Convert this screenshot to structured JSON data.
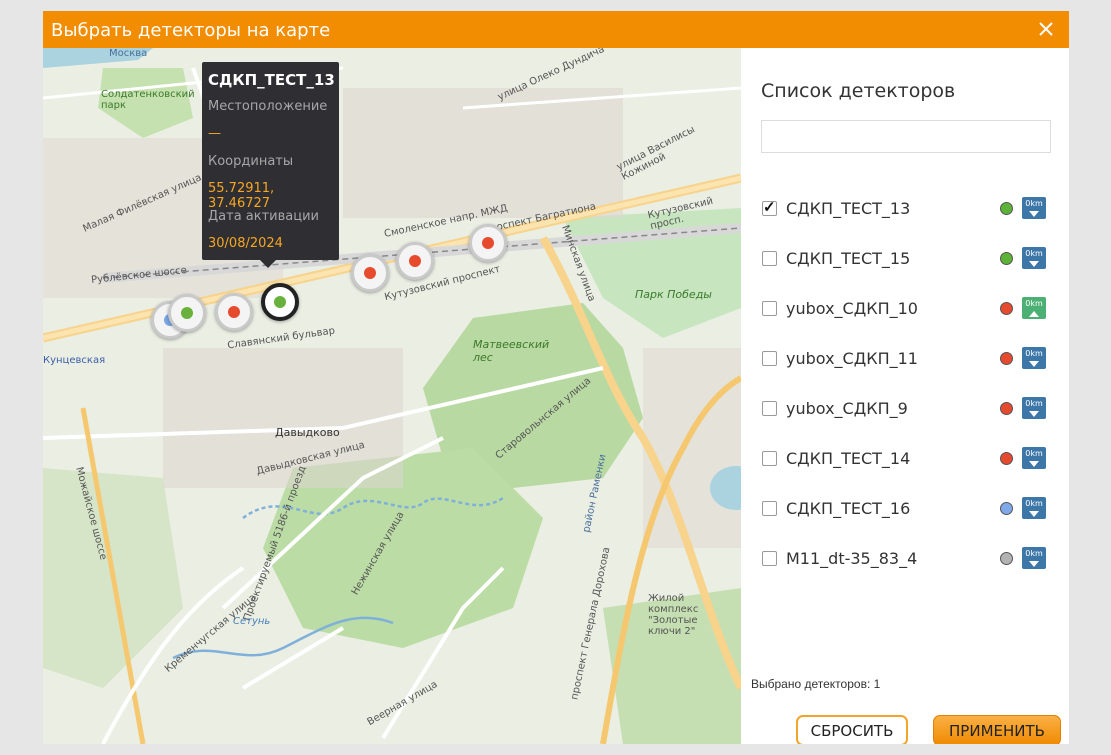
{
  "dialog": {
    "title": "Выбрать детекторы на карте",
    "close_icon": "close-icon"
  },
  "map": {
    "labels": {
      "park_soldatenkovsky": "Солдатенковский парк",
      "malaya_filevskaya": "Малая Филёвская улица",
      "rublevskoe": "Рублёвское шоссе",
      "kutuzovsky": "Кутузовский проспект",
      "kutuzovsky_short": "Кутузовский просп.",
      "slavyansky": "Славянский бульвар",
      "matveevsky": "Матвеевский лес",
      "park_pobedy": "Парк Победы",
      "davydkovo": "Давыдково",
      "davydkovskaya": "Давыдковская улица",
      "starovolynskaya": "Старовольнская улица",
      "minskaya": "Минская улица",
      "setun": "Сетунь",
      "nezhinskaya": "Нежинская улица",
      "veernaya": "Веерная улица",
      "kremenchugskaya": "Кременчугская улица",
      "mozhayskoe": "Можайское шоссе",
      "general_dorokhov": "проспект Генерала Дорохова",
      "ramenki": "район Раменки",
      "zolotye_klyuchi": "Жилой комплекс \"Золотые ключи 2\"",
      "vasilisy_kozhinoy": "улица Василисы Кожиной",
      "olexa_dundicha": "улица Олеко Дундича",
      "kuntsevskaya": "Кунцевская",
      "moskva": "Москва",
      "smolenskoe": "Смоленское напр. МЖД",
      "bagrationa": "проспект Багратиона",
      "proektiruemy": "Проектируемый 5186-й проезд",
      "ramenki2": "Раменки"
    },
    "markers": [
      {
        "name": "marker-blue",
        "color": "#7aa6e6"
      },
      {
        "name": "marker-green-left",
        "color": "#69b03c"
      },
      {
        "name": "marker-red-1",
        "color": "#e74b2e"
      },
      {
        "name": "marker-selected",
        "color": "#69b03c"
      },
      {
        "name": "marker-red-2",
        "color": "#e74b2e"
      },
      {
        "name": "marker-red-3",
        "color": "#e74b2e"
      },
      {
        "name": "marker-red-4",
        "color": "#e74b2e"
      }
    ],
    "tooltip": {
      "name": "СДКП_ТЕСТ_13",
      "location_label": "Местоположение",
      "location_value": "—",
      "coords_label": "Координаты",
      "coords_value": "55.72911, 37.46727",
      "activation_label": "Дата активации",
      "activation_value": "30/08/2024"
    }
  },
  "panel": {
    "title": "Список детекторов",
    "search_value": "",
    "search_placeholder": "",
    "detectors": [
      {
        "name": "СДКП_ТЕСТ_13",
        "checked": true,
        "status_color": "#5cb338",
        "km": "0km",
        "km_color": "#3d77a8",
        "arrow": "down"
      },
      {
        "name": "СДКП_ТЕСТ_15",
        "checked": false,
        "status_color": "#5cb338",
        "km": "0km",
        "km_color": "#3d77a8",
        "arrow": "down"
      },
      {
        "name": "yubox_СДКП_10",
        "checked": false,
        "status_color": "#e64a2e",
        "km": "0km",
        "km_color": "#4caf73",
        "arrow": "up"
      },
      {
        "name": "yubox_СДКП_11",
        "checked": false,
        "status_color": "#e64a2e",
        "km": "0km",
        "km_color": "#3d77a8",
        "arrow": "down"
      },
      {
        "name": "yubox_СДКП_9",
        "checked": false,
        "status_color": "#e64a2e",
        "km": "0km",
        "km_color": "#3d77a8",
        "arrow": "down"
      },
      {
        "name": "СДКП_ТЕСТ_14",
        "checked": false,
        "status_color": "#e64a2e",
        "km": "0km",
        "km_color": "#3d77a8",
        "arrow": "down"
      },
      {
        "name": "СДКП_ТЕСТ_16",
        "checked": false,
        "status_color": "#7fa9e8",
        "km": "0km",
        "km_color": "#3d77a8",
        "arrow": "down"
      },
      {
        "name": "M11_dt-35_83_4",
        "checked": false,
        "status_color": "#b3b3b3",
        "km": "0km",
        "km_color": "#3d77a8",
        "arrow": "down"
      }
    ],
    "selected_count": "Выбрано детекторов: 1",
    "reset_label": "СБРОСИТЬ",
    "apply_label": "ПРИМЕНИТЬ"
  },
  "colors": {
    "accent": "#f28c00",
    "tooltip_bg": "#2f2f33",
    "tooltip_value": "#f6a623"
  }
}
